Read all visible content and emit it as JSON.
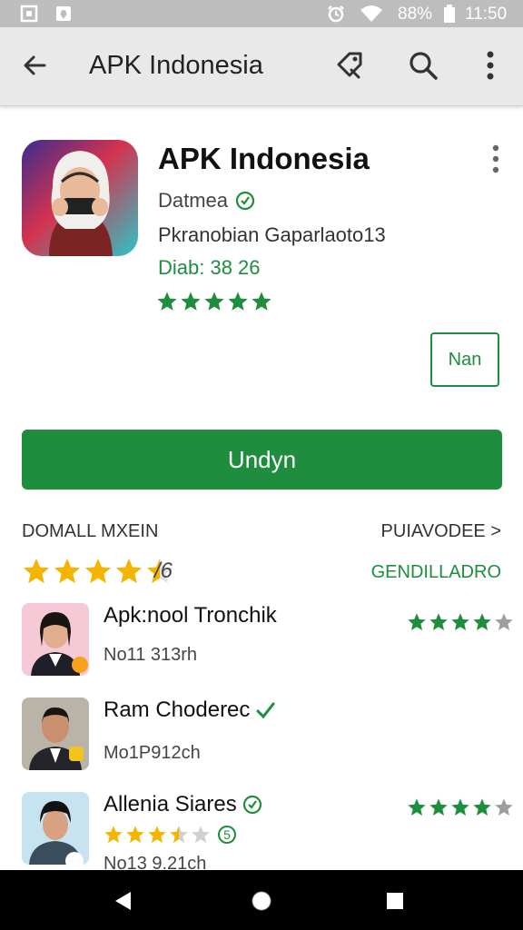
{
  "status_bar": {
    "battery_text": "88%",
    "time": "11:50",
    "icons": [
      "screenshot-icon",
      "location-icon",
      "alarm-icon",
      "wifi-icon",
      "battery-icon"
    ]
  },
  "app_bar": {
    "title": "APK Indonesia",
    "actions": [
      "back-arrow-icon",
      "share-tag-icon",
      "search-icon",
      "more-vert-icon"
    ]
  },
  "app": {
    "name": "APK Indonesia",
    "developer": "Datmea",
    "line2": "Pkranobian Gaparlaoto13",
    "line3": "Diab: 38 26",
    "rating_stars": 5,
    "new_button": "Nan",
    "install_button": "Undyn"
  },
  "section": {
    "left": "DOMALL MXEIN",
    "right": "PUIAVODEE >",
    "green_link": "GENDILLADRO",
    "rating_value": 4.5,
    "rating_text": "/6"
  },
  "reviews": [
    {
      "name": "Apk:nool Tronchik",
      "time": "No11 313rh",
      "stars": 4,
      "verified": false
    },
    {
      "name": "Ram Choderec",
      "time": "Mo1P912ch",
      "stars": 0,
      "verified": true
    },
    {
      "name": "Allenia Siares",
      "time": "No13 9.21ch",
      "stars": 4,
      "verified": true,
      "inline_rating": 3.5,
      "inline_badge": "5"
    }
  ],
  "colors": {
    "accent_green": "#1e8e3e",
    "star_yellow": "#f4b400",
    "app_bar": "#e9e9e9",
    "status_bar": "#bdbdbd"
  }
}
